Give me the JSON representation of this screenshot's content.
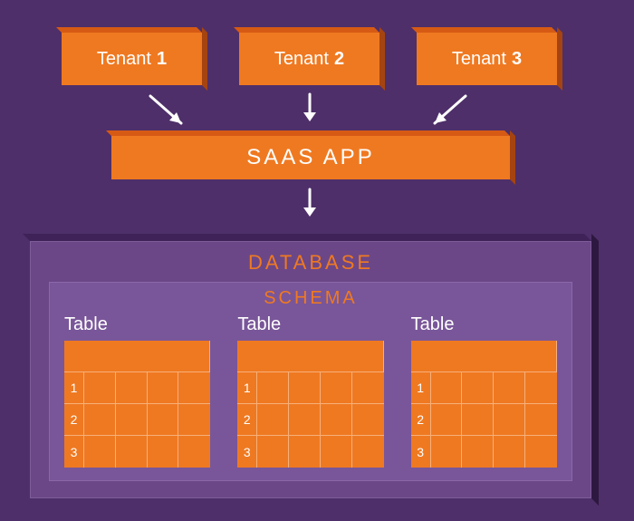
{
  "tenants": [
    {
      "label": "Tenant",
      "num": "1"
    },
    {
      "label": "Tenant",
      "num": "2"
    },
    {
      "label": "Tenant",
      "num": "3"
    }
  ],
  "saas": {
    "label": "SAAS APP"
  },
  "database": {
    "title": "DATABASE",
    "schema": {
      "title": "SCHEMA",
      "tables": [
        {
          "label": "Table",
          "rows": [
            "1",
            "2",
            "3"
          ]
        },
        {
          "label": "Table",
          "rows": [
            "1",
            "2",
            "3"
          ]
        },
        {
          "label": "Table",
          "rows": [
            "1",
            "2",
            "3"
          ]
        }
      ]
    }
  },
  "colors": {
    "bg": "#4e2f69",
    "orange": "#ef7921",
    "orange_dark": "#d65a14",
    "orange_darker": "#a54410",
    "panel": "#6b4788",
    "panel_inner": "#795699"
  }
}
